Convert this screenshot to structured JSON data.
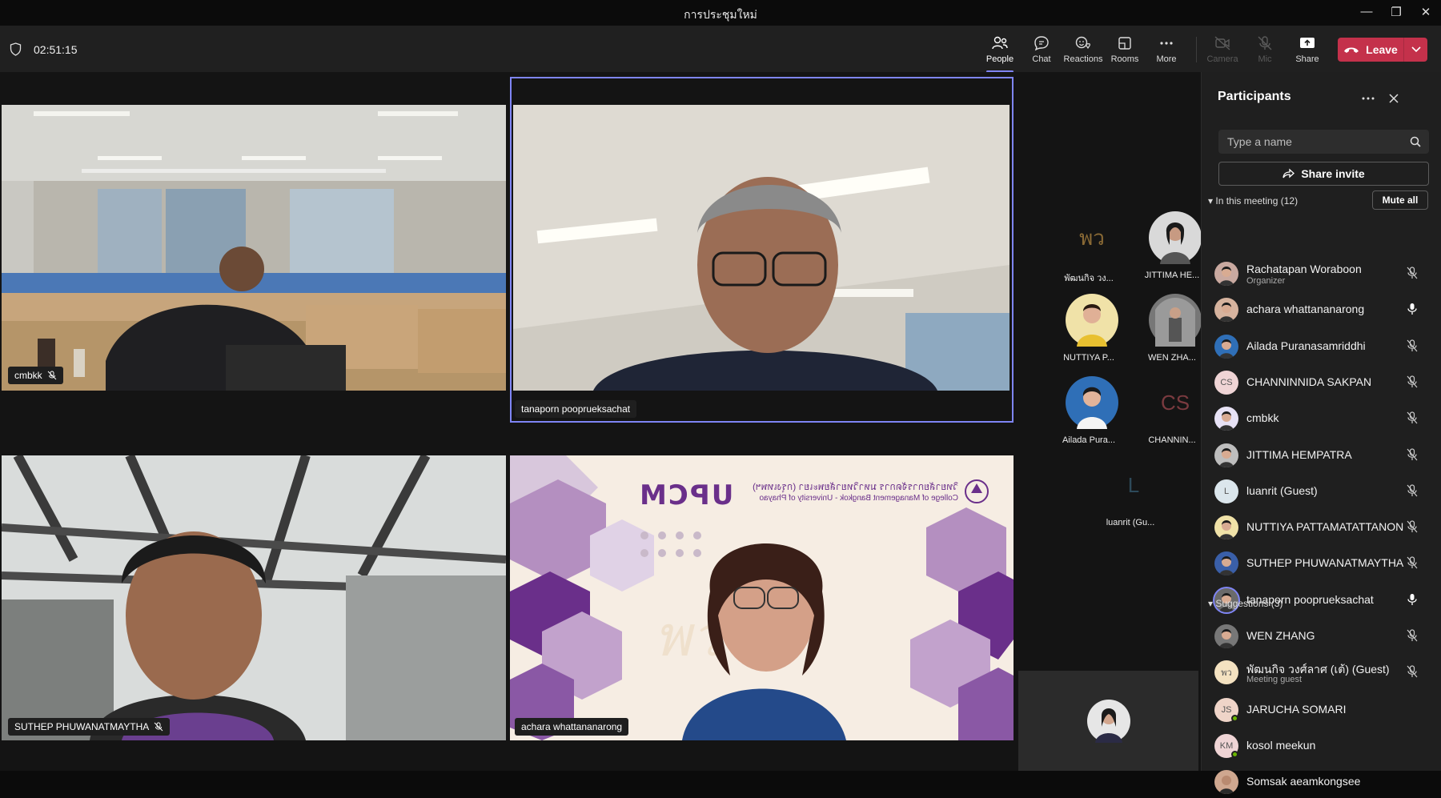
{
  "window": {
    "title": "การประชุมใหม่",
    "controls": [
      "minimize-icon",
      "restore-icon",
      "close-icon"
    ]
  },
  "toolbar": {
    "timer": "02:51:15",
    "buttons": [
      {
        "label": "People",
        "icon": "people-icon",
        "state": "active"
      },
      {
        "label": "Chat",
        "icon": "chat-icon",
        "state": "normal"
      },
      {
        "label": "Reactions",
        "icon": "reactions-icon",
        "state": "normal"
      },
      {
        "label": "Rooms",
        "icon": "rooms-icon",
        "state": "normal"
      },
      {
        "label": "More",
        "icon": "more-icon",
        "state": "normal"
      },
      {
        "label": "Camera",
        "icon": "camera-off-icon",
        "state": "disabled"
      },
      {
        "label": "Mic",
        "icon": "mic-off-icon",
        "state": "disabled"
      },
      {
        "label": "Share",
        "icon": "share-icon",
        "state": "normal"
      }
    ],
    "leave_label": "Leave"
  },
  "video_tiles": [
    {
      "name": "cmbkk",
      "muted": true
    },
    {
      "name": "tanaporn pooprueksachat",
      "muted": false
    },
    {
      "name": "SUTHEP PHUWANATMAYTHA",
      "muted": true
    },
    {
      "name": "achara whattananarong",
      "muted": false
    }
  ],
  "slide": {
    "brand": "UPCM",
    "line1": "วิทยาลัยการจัดการ มหาวิทยาลัยพะเยา (กรุงเทพฯ)",
    "line2": "College of Management Bangkok - University of Phayao"
  },
  "rail": [
    {
      "label": "พัฒนกิจ วง...",
      "initials": "พว",
      "bg": "#f4e2c1"
    },
    {
      "label": "JITTIMA HE...",
      "initials": "",
      "bg": "#d9d9d9"
    },
    {
      "label": "NUTTIYA P...",
      "initials": "",
      "bg": "#f0e2a8"
    },
    {
      "label": "WEN ZHA...",
      "initials": "",
      "bg": "#777777"
    },
    {
      "label": "Ailada Pura...",
      "initials": "",
      "bg": "#2f6fb7"
    },
    {
      "label": "CHANNIN...",
      "initials": "CS",
      "bg": "#efd4d5"
    },
    {
      "label": "luanrit (Gu...",
      "initials": "L",
      "bg": "#dbe6ec"
    }
  ],
  "participants": {
    "title": "Participants",
    "search_placeholder": "Type a name",
    "invite_label": "Share invite",
    "in_meeting_label": "In this meeting (12)",
    "mute_all_label": "Mute all",
    "suggestions_label": "Suggestions (3)",
    "members": [
      {
        "name": "Rachatapan Woraboon",
        "sub": "Organizer",
        "initials": "",
        "bg": "#c9a9a0",
        "mic": "off"
      },
      {
        "name": "achara whattananarong",
        "sub": "",
        "initials": "",
        "bg": "#d6b39e",
        "mic": "on"
      },
      {
        "name": "Ailada Puranasamriddhi",
        "sub": "",
        "initials": "",
        "bg": "#2f6fb7",
        "mic": "off"
      },
      {
        "name": "CHANNINNIDA SAKPAN",
        "sub": "",
        "initials": "CS",
        "bg": "#efd4d5",
        "mic": "off"
      },
      {
        "name": "cmbkk",
        "sub": "",
        "initials": "",
        "bg": "#e7e2f5",
        "mic": "off"
      },
      {
        "name": "JITTIMA HEMPATRA",
        "sub": "",
        "initials": "",
        "bg": "#bdbdbd",
        "mic": "off"
      },
      {
        "name": "luanrit (Guest)",
        "sub": "",
        "initials": "L",
        "bg": "#dbe6ec",
        "mic": "off"
      },
      {
        "name": "NUTTIYA PATTAMATATTANON",
        "sub": "",
        "initials": "",
        "bg": "#f0e2a8",
        "mic": "off"
      },
      {
        "name": "SUTHEP PHUWANATMAYTHA",
        "sub": "",
        "initials": "",
        "bg": "#3a5fa8",
        "mic": "off"
      },
      {
        "name": "tanaporn pooprueksachat",
        "sub": "",
        "initials": "",
        "bg": "#6a6a6a",
        "mic": "on",
        "speaking": true
      },
      {
        "name": "WEN ZHANG",
        "sub": "",
        "initials": "",
        "bg": "#777777",
        "mic": "off"
      },
      {
        "name": "พัฒนกิจ วงศ์ลาศ (เต้) (Guest)",
        "sub": "Meeting guest",
        "initials": "พว",
        "bg": "#f4e2c1",
        "mic": "off"
      }
    ],
    "suggestions": [
      {
        "name": "JARUCHA SOMARI",
        "initials": "JS",
        "bg": "#efd4c8"
      },
      {
        "name": "kosol meekun",
        "initials": "KM",
        "bg": "#efd4d5"
      },
      {
        "name": "Somsak aeamkongsee",
        "initials": "",
        "bg": "#cfa78f"
      }
    ]
  },
  "colors": {
    "accent": "#7f85f5",
    "leave": "#c4314b",
    "online": "#6bb700"
  }
}
